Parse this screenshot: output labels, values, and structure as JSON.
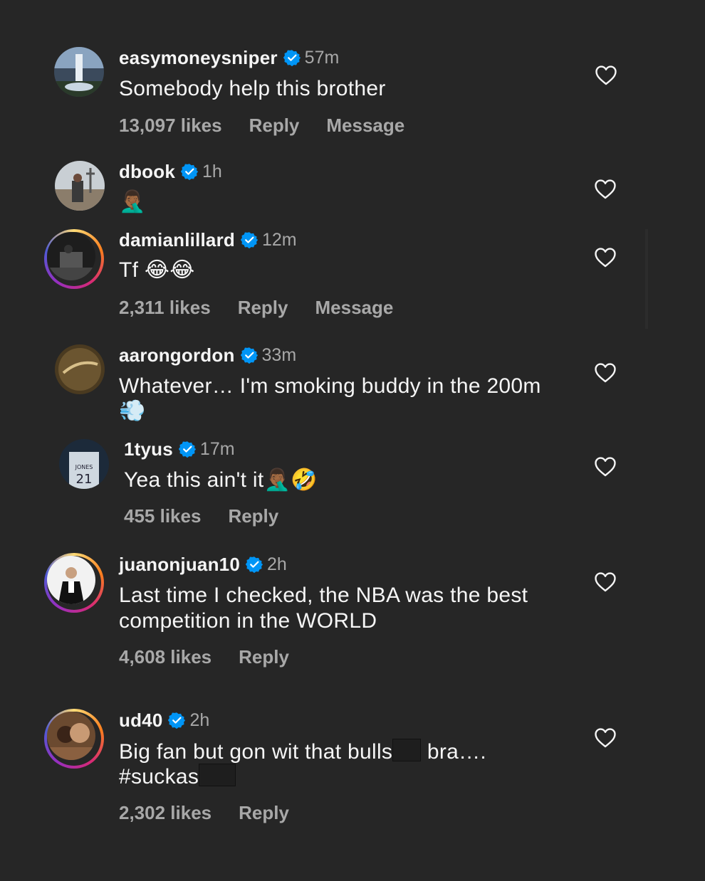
{
  "comments": [
    {
      "username": "easymoneysniper",
      "time": "57m",
      "text": "Somebody help this brother",
      "likes": "13,097 likes",
      "reply": "Reply",
      "message": "Message"
    },
    {
      "username": "dbook",
      "time": "1h",
      "text": "🤦🏾‍♂️"
    },
    {
      "username": "damianlillard",
      "time": "12m",
      "text": "Tf 😂😂",
      "likes": "2,311 likes",
      "reply": "Reply",
      "message": "Message"
    },
    {
      "username": "aarongordon",
      "time": "33m",
      "text": "Whatever… I'm smoking buddy in the 200m",
      "text2": "💨"
    },
    {
      "username": "1tyus",
      "time": "17m",
      "text": "Yea this ain't it🤦🏾‍♂️🤣",
      "likes": "455 likes",
      "reply": "Reply"
    },
    {
      "username": "juanonjuan10",
      "time": "2h",
      "text": "Last time I checked, the NBA was the best",
      "text2": "competition in the WORLD",
      "likes": "4,608 likes",
      "reply": "Reply"
    },
    {
      "username": "ud40",
      "time": "2h",
      "text_a": "Big fan but gon wit that bulls",
      "text_b": " bra….",
      "text2": "#suckas",
      "likes": "2,302 likes",
      "reply": "Reply"
    }
  ],
  "icons": {
    "verified": "verified-badge-icon",
    "like": "heart-icon"
  },
  "colors": {
    "background": "#262626",
    "verified": "#0095f6",
    "secondary": "#a8a8a8"
  }
}
